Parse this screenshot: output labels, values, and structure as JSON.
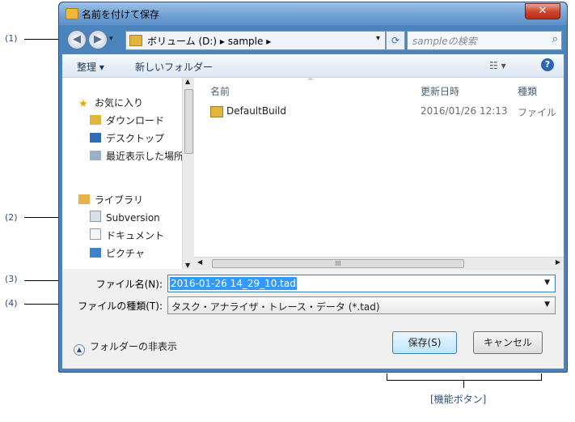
{
  "dialog": {
    "title": "名前を付けて保存",
    "close": "✕",
    "address": "ボリューム (D:)  ▸  sample  ▸",
    "search_placeholder": "sampleの検索",
    "toolbar": {
      "organize": "整理 ▾",
      "new_folder": "新しいフォルダー"
    },
    "nav": {
      "items": [
        {
          "label": "お気に入り"
        },
        {
          "label": "ダウンロード"
        },
        {
          "label": "デスクトップ"
        },
        {
          "label": "最近表示した場所"
        },
        {
          "label": "ライブラリ"
        },
        {
          "label": "Subversion"
        },
        {
          "label": "ドキュメント"
        },
        {
          "label": "ピクチャ"
        }
      ]
    },
    "columns": {
      "name": "名前",
      "modified": "更新日時",
      "type": "種類"
    },
    "files": [
      {
        "name": "DefaultBuild",
        "modified": "2016/01/26 12:13",
        "type": "ファイル"
      }
    ],
    "filename_label": "ファイル名(N):",
    "filename_value": "2016-01-26 14_29_10.tad",
    "filetype_label": "ファイルの種類(T):",
    "filetype_value": "タスク・アナライザ・トレース・データ (*.tad)",
    "hide_folders": "フォルダーの非表示",
    "save_button": "保存(S)",
    "cancel_button": "キャンセル"
  },
  "callouts": {
    "c1": "(1)",
    "c2": "(2)",
    "c3": "(3)",
    "c4": "(4)",
    "function_buttons": "[機能ボタン]"
  },
  "colors": {
    "window_frame": "#4a84bd",
    "selection": "#3399ff",
    "callout_text": "#2b4f8a"
  }
}
